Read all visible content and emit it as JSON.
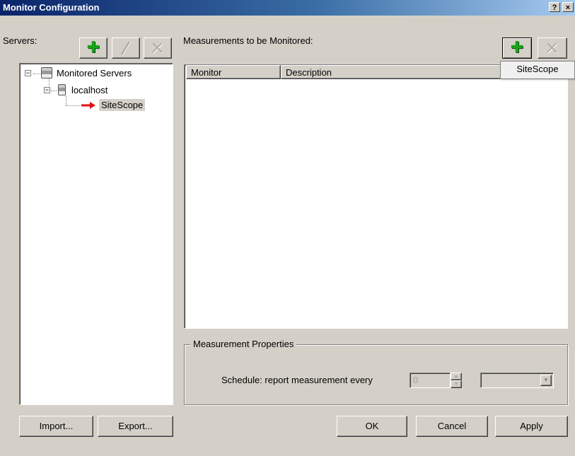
{
  "window": {
    "title": "Monitor Configuration",
    "help_button": "?",
    "close_button": "×"
  },
  "servers": {
    "label": "Servers:",
    "tree": [
      {
        "label": "Monitored Servers",
        "expander": "−"
      },
      {
        "label": "localhost",
        "expander": "−"
      },
      {
        "label": "SiteScope",
        "selected": true
      }
    ]
  },
  "measurements": {
    "label": "Measurements to be Monitored:",
    "columns": [
      "Monitor",
      "Description"
    ],
    "rows": [],
    "add_menu_item": "SiteScope"
  },
  "properties": {
    "group_label": "Measurement Properties",
    "schedule_label": "Schedule: report measurement every",
    "schedule_value": "0",
    "unit_value": ""
  },
  "buttons": {
    "import": "Import...",
    "export": "Export...",
    "ok": "OK",
    "cancel": "Cancel",
    "apply": "Apply"
  },
  "icons": {
    "add": "plus-icon",
    "edit": "pencil-icon",
    "delete": "x-icon",
    "server": "server-icon",
    "arrow": "red-arrow-icon"
  },
  "colors": {
    "titlebar_start": "#0a246a",
    "titlebar_end": "#a6caf0",
    "add_icon": "#1aa31a",
    "arrow": "#e01010",
    "face": "#d4d0c8"
  }
}
